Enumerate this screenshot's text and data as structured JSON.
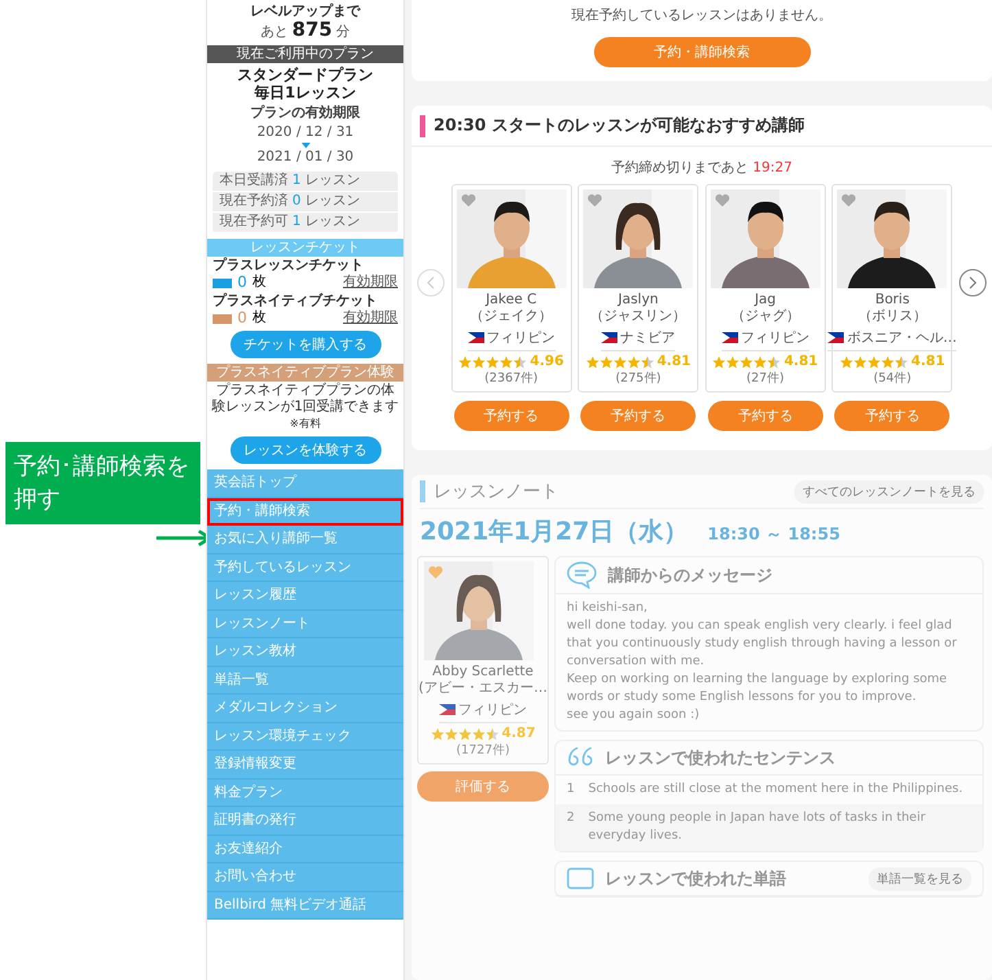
{
  "callout": {
    "text": "予約･講師検索を押す"
  },
  "sidebar": {
    "level_up": {
      "label": "レベルアップまで",
      "prefix": "あと",
      "value": "875",
      "unit": "分"
    },
    "plan": {
      "header": "現在ご利用中のプラン",
      "name_lines": [
        "スタンダードプラン",
        "毎日1レッスン"
      ],
      "validity_label": "プランの有効期限",
      "start": "2020 / 12 / 31",
      "end": "2021 / 01 / 30"
    },
    "stats": [
      {
        "label": "本日受講済",
        "count": "1",
        "unit": "レッスン"
      },
      {
        "label": "現在予約済",
        "count": "0",
        "unit": "レッスン"
      },
      {
        "label": "現在予約可",
        "count": "1",
        "unit": "レッスン"
      }
    ],
    "tickets": {
      "header": "レッスンチケット",
      "items": [
        {
          "name": "プラスレッスンチケット",
          "color": "#1a9fe0",
          "count": "0",
          "unit": "枚",
          "link": "有効期限"
        },
        {
          "name": "プラスネイティブチケット",
          "color": "#d9956a",
          "count": "0",
          "unit": "枚",
          "link": "有効期限"
        }
      ],
      "button": "チケットを購入する"
    },
    "trial": {
      "header": "プラスネイティブプラン体験",
      "text": "プラスネイティブプランの体験レッスンが1回受講できます",
      "note": "※有料",
      "button": "レッスンを体験する"
    },
    "menu": [
      {
        "label": "英会話トップ",
        "highlighted": false
      },
      {
        "label": "予約・講師検索",
        "highlighted": true
      },
      {
        "label": "お気に入り講師一覧",
        "highlighted": false
      },
      {
        "label": "予約しているレッスン",
        "highlighted": false
      },
      {
        "label": "レッスン履歴",
        "highlighted": false
      },
      {
        "label": "レッスンノート",
        "highlighted": false
      },
      {
        "label": "レッスン教材",
        "highlighted": false
      },
      {
        "label": "単語一覧",
        "highlighted": false
      },
      {
        "label": "メダルコレクション",
        "highlighted": false
      },
      {
        "label": "レッスン環境チェック",
        "highlighted": false
      },
      {
        "label": "登録情報変更",
        "highlighted": false
      },
      {
        "label": "料金プラン",
        "highlighted": false
      },
      {
        "label": "証明書の発行",
        "highlighted": false
      },
      {
        "label": "お友達紹介",
        "highlighted": false
      },
      {
        "label": "お問い合わせ",
        "highlighted": false
      },
      {
        "label": "Bellbird 無料ビデオ通話",
        "highlighted": false
      }
    ]
  },
  "reservation": {
    "message": "現在予約しているレッスンはありません。",
    "button": "予約・講師検索"
  },
  "recommend": {
    "title": "20:30 スタートのレッスンが可能なおすすめ講師",
    "deadline_label": "予約締め切りまであと",
    "deadline_time": "19:27",
    "teachers": [
      {
        "name": "Jakee C",
        "kana": "（ジェイク）",
        "country": "フィリピン",
        "stars": 4.5,
        "rating": "4.96",
        "reviews": "(2367件)",
        "button": "予約する"
      },
      {
        "name": "Jaslyn",
        "kana": "（ジャスリン）",
        "country": "ナミビア",
        "stars": 4.5,
        "rating": "4.81",
        "reviews": "(275件)",
        "button": "予約する"
      },
      {
        "name": "Jag",
        "kana": "（ジャグ）",
        "country": "フィリピン",
        "stars": 4.5,
        "rating": "4.81",
        "reviews": "(27件)",
        "button": "予約する"
      },
      {
        "name": "Boris",
        "kana": "（ボリス）",
        "country": "ボスニア・ヘル…",
        "stars": 4.5,
        "rating": "4.81",
        "reviews": "(54件)",
        "button": "予約する"
      }
    ]
  },
  "lesson_note": {
    "title": "レッスンノート",
    "all_link": "すべてのレッスンノートを見る",
    "date": "2021年1月27日（水）",
    "time": "18:30 ～ 18:55",
    "teacher": {
      "name": "Abby Scarlette",
      "kana": "(アビー・エスカー…",
      "country": "フィリピン",
      "stars": 4.5,
      "rating": "4.87",
      "reviews": "(1727件)",
      "button": "評価する"
    },
    "message_title": "講師からのメッセージ",
    "message_lines": [
      "hi keishi-san,",
      "well done today. you can speak english very clearly. i feel glad that you continuously study english through having a lesson or conversation with me.",
      "Keep on working on learning the language by exploring some words or study some English lessons for you to improve.",
      "see you again soon :)"
    ],
    "sentences_title": "レッスンで使われたセンテンス",
    "sentences": [
      {
        "number": "1",
        "text": "Schools are still close at the moment here in the Philippines."
      },
      {
        "number": "2",
        "text": "Some young people in Japan have lots of tasks in their everyday lives."
      }
    ],
    "words_title": "レッスンで使われた単語",
    "words_link": "単語一覧を見る"
  }
}
